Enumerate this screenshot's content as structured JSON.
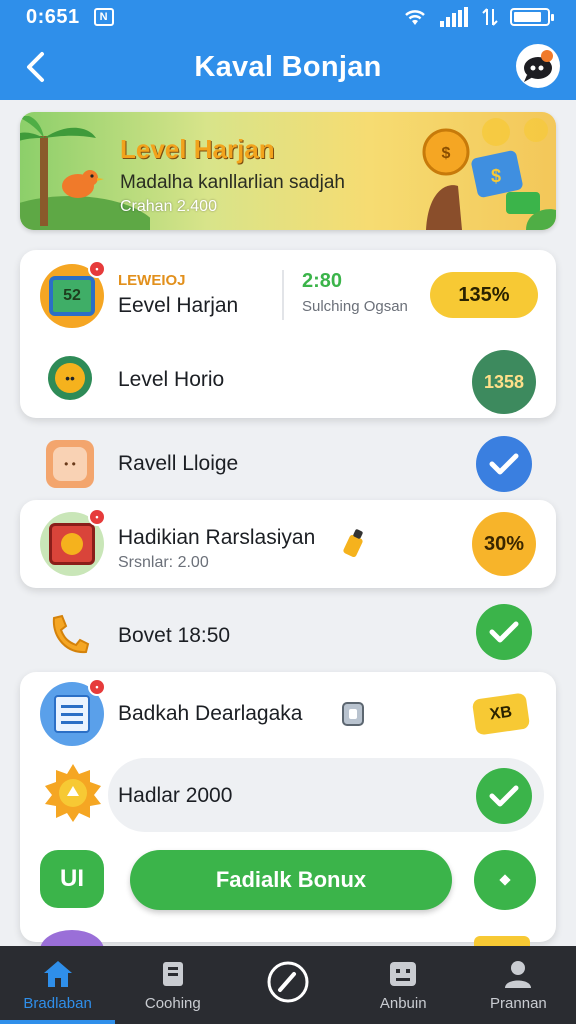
{
  "status": {
    "time": "0:651",
    "notif": "N"
  },
  "header": {
    "title": "Kaval Bonjan"
  },
  "banner": {
    "title": "Level Harjan",
    "subtitle": "Madalha kanllarlian sadjah",
    "meta": "Crahan 2.400"
  },
  "rows": {
    "r1": {
      "eyebrow": "LEWEIOJ",
      "label": "Eevel Harjan",
      "value": "2:80",
      "value_sub": "Sulching Ogsan",
      "pill": "135%",
      "icon_text": "52"
    },
    "r2": {
      "label": "Level Horio",
      "circle": "1358"
    },
    "r3": {
      "label": "Ravell Lloige"
    },
    "r4": {
      "label": "Hadikian Rarslasiyan",
      "sub": "Srsnlar: 2.00",
      "circle": "30%"
    },
    "r5": {
      "label": "Bovet 18:50"
    },
    "r6": {
      "label": "Badkah Dearlagaka",
      "tag": "XB"
    },
    "r7": {
      "label": "Hadlar 2000"
    },
    "r8": {
      "icon_text": "UI",
      "button": "Fadialk Bonux"
    }
  },
  "nav": [
    {
      "label": "Bradlaban"
    },
    {
      "label": "Coohing"
    },
    {
      "label": ""
    },
    {
      "label": "Anbuin"
    },
    {
      "label": "Prannan"
    }
  ],
  "colors": {
    "primary": "#2f8fea",
    "green": "#3bb44a",
    "yellow": "#f7c934",
    "nav": "#2a2c31"
  }
}
